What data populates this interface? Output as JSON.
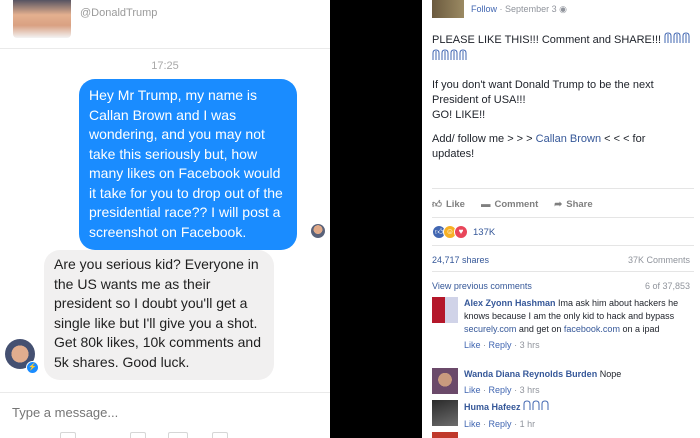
{
  "messenger": {
    "header": {
      "handle": "@DonaldTrump"
    },
    "timestamp": "17:25",
    "messages": [
      {
        "direction": "outgoing",
        "text": "Hey Mr Trump, my name is Callan Brown and I was wondering, and you may not take this seriously but, how many likes on Facebook would it take for you to drop out of the presidential race?? I will post a screenshot on Facebook."
      },
      {
        "direction": "incoming",
        "text": "Are you serious kid? Everyone in the US wants me as their president so I doubt you'll get a single like but I'll give you a shot. Get 80k likes, 10k comments and 5k shares. Good luck."
      }
    ],
    "composer_placeholder": "Type a message..."
  },
  "facebook": {
    "meta": {
      "follow": "Follow",
      "date": "September 3",
      "dot": "·"
    },
    "post": {
      "line1": "PLEASE LIKE THIS!!! Comment and SHARE!!!",
      "line2a": "If you don't want Donald Trump to be the next",
      "line2b": "President of USA!!!",
      "line2c": "GO! LIKE!!",
      "line3a": "Add/ follow me > > > ",
      "line3link": "Callan Brown",
      "line3b": " < < < for",
      "line3c": "updates!"
    },
    "actions": {
      "like": "Like",
      "comment": "Comment",
      "share": "Share"
    },
    "reactions_count": "137K",
    "shares": "24,717 shares",
    "comments_count": "37K Comments",
    "view_previous": "View previous comments",
    "comments_pager": "6 of 37,853",
    "comments": [
      {
        "name": "Alex Zyonn Hashman",
        "t1": " Ima ask him about hackers he knows because I am the only kid to hack and bypass ",
        "link1": "securely.com",
        "t2": " and get on ",
        "link2": "facebook.com",
        "t3": " on a ipad",
        "like": "Like",
        "reply": "Reply",
        "age": "3 hrs"
      },
      {
        "name": "Wanda Diana Reynolds Burden",
        "t1": " Nope",
        "like": "Like",
        "reply": "Reply",
        "age": "3 hrs"
      },
      {
        "name": "Huma Hafeez",
        "like": "Like",
        "reply": "Reply",
        "age": "1 hr"
      }
    ],
    "separator": "·"
  }
}
